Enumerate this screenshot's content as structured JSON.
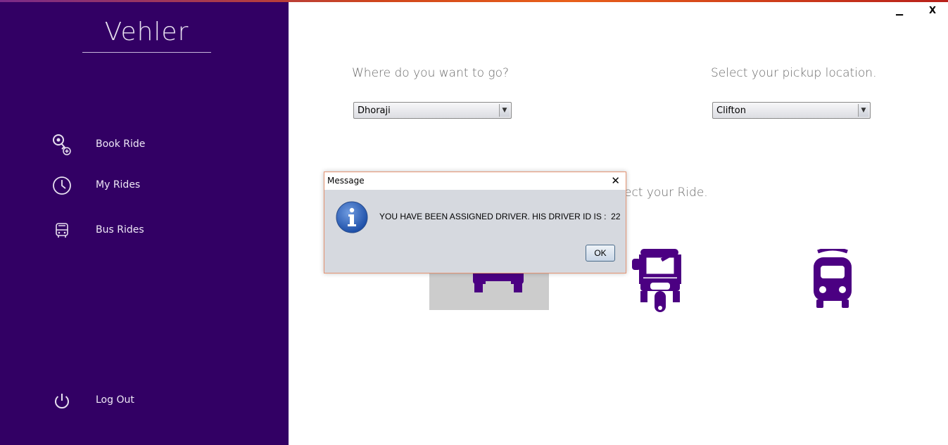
{
  "app": {
    "brand": "Vehler"
  },
  "window_controls": {
    "minimize": "▁",
    "close": "X"
  },
  "sidebar": {
    "items": [
      {
        "label": "Book Ride",
        "icon": "key-plus-icon"
      },
      {
        "label": "My Rides",
        "icon": "clock-icon"
      },
      {
        "label": "Bus Rides",
        "icon": "bus-icon"
      },
      {
        "label": "Log Out",
        "icon": "power-icon"
      }
    ]
  },
  "main": {
    "destination": {
      "prompt": "Where do you want to go?",
      "value": "Dhoraji"
    },
    "pickup": {
      "prompt": "Select your pickup location.",
      "value": "Clifton"
    },
    "ride_prompt_visible": "ect your Ride.",
    "rides": [
      {
        "icon": "car-icon",
        "selected": true
      },
      {
        "icon": "rickshaw-icon",
        "selected": false
      },
      {
        "icon": "train-icon",
        "selected": false
      }
    ]
  },
  "dialog": {
    "title": "Message",
    "close": "✕",
    "message": "YOU HAVE BEEN ASSIGNED DRIVER. HIS DRIVER ID IS :  22",
    "ok": "OK",
    "icon": "info-icon"
  },
  "colors": {
    "sidebar": "#320064",
    "accent": "#4b0082",
    "dialog_bg": "#d6d9df",
    "selected_ride_bg": "#cccccc"
  }
}
